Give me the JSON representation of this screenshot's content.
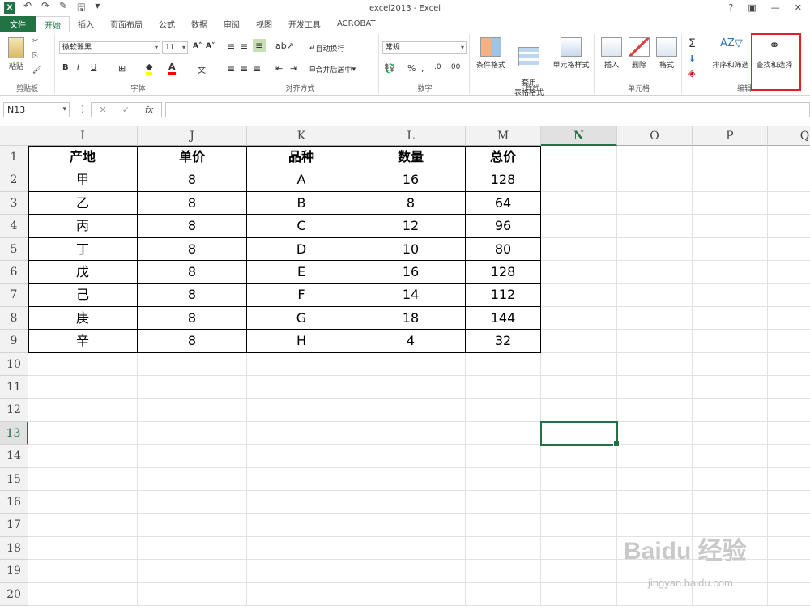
{
  "window": {
    "title": "excel2013 - Excel",
    "help": "?",
    "restore": "▣",
    "minimize": "—",
    "close": "✕"
  },
  "tabs": [
    {
      "label": "文件"
    },
    {
      "label": "开始"
    },
    {
      "label": "插入"
    },
    {
      "label": "页面布局"
    },
    {
      "label": "公式"
    },
    {
      "label": "数据"
    },
    {
      "label": "审阅"
    },
    {
      "label": "视图"
    },
    {
      "label": "开发工具"
    },
    {
      "label": "ACROBAT"
    }
  ],
  "ribbon": {
    "paste": "粘贴",
    "clipboard": "剪贴板",
    "font_name": "微软雅黑",
    "font_size": "11",
    "font_group": "字体",
    "wrap_text": "自动换行",
    "merge_center": "合并后居中",
    "alignment_group": "对齐方式",
    "number_format": "常规",
    "number_group": "数字",
    "conditional_format": "条件格式",
    "format_as_table": "套用\n表格格式",
    "cell_styles": "单元格样式",
    "styles_group": "样式",
    "insert": "插入",
    "delete": "删除",
    "format": "格式",
    "cells_group": "单元格",
    "sort_filter": "排序和筛选",
    "find_select": "查找和选择",
    "editing_group": "编辑"
  },
  "formula_bar": {
    "name_box": "N13",
    "cancel": "✕",
    "enter": "✓",
    "fx": "fx",
    "formula": ""
  },
  "columns": [
    "I",
    "J",
    "K",
    "L",
    "M",
    "N",
    "O",
    "P",
    "Q"
  ],
  "selected_column": "N",
  "rows": [
    "1",
    "2",
    "3",
    "4",
    "5",
    "6",
    "7",
    "8",
    "9",
    "10",
    "11",
    "12",
    "13",
    "14",
    "15",
    "16",
    "17",
    "18",
    "19",
    "20"
  ],
  "selected_row": "13",
  "table": {
    "headers": [
      "产地",
      "单价",
      "品种",
      "数量",
      "总价"
    ],
    "rows": [
      [
        "甲",
        "8",
        "A",
        "16",
        "128"
      ],
      [
        "乙",
        "8",
        "B",
        "8",
        "64"
      ],
      [
        "丙",
        "8",
        "C",
        "12",
        "96"
      ],
      [
        "丁",
        "8",
        "D",
        "10",
        "80"
      ],
      [
        "戊",
        "8",
        "E",
        "16",
        "128"
      ],
      [
        "己",
        "8",
        "F",
        "14",
        "112"
      ],
      [
        "庚",
        "8",
        "G",
        "18",
        "144"
      ],
      [
        "辛",
        "8",
        "H",
        "4",
        "32"
      ]
    ]
  },
  "watermark": {
    "brand": "Baidu 经验",
    "url": "jingyan.baidu.com"
  },
  "colors": {
    "accent": "#217346",
    "highlight": "#e02020"
  }
}
